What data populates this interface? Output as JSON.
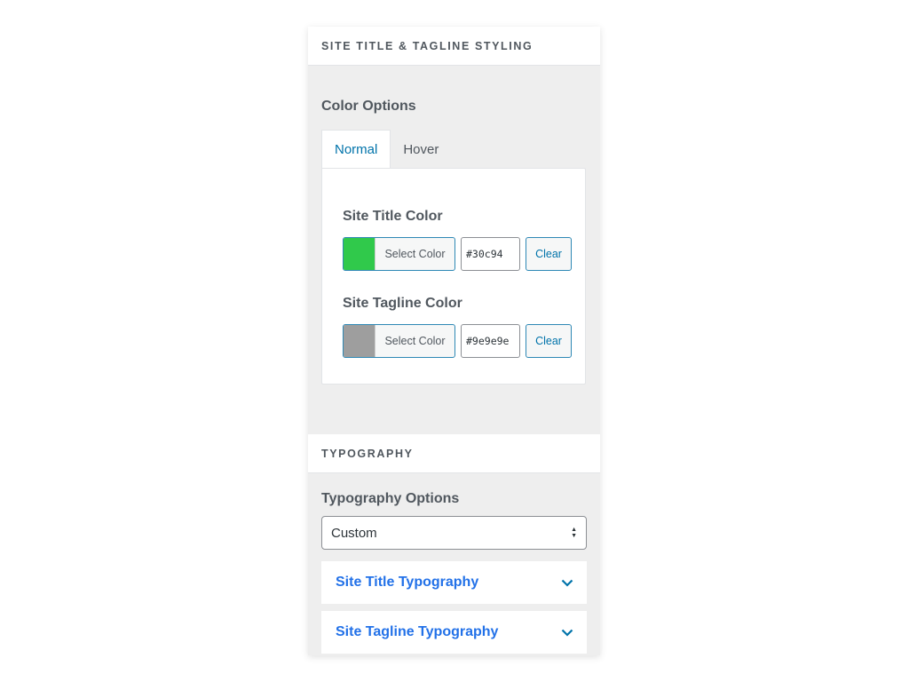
{
  "section_site_title": {
    "heading": "SITE TITLE & TAGLINE STYLING",
    "color_options_title": "Color Options",
    "tabs": [
      {
        "label": "Normal",
        "active": true
      },
      {
        "label": "Hover",
        "active": false
      }
    ],
    "fields": [
      {
        "label": "Site Title Color",
        "swatch_color": "#30c94b",
        "button_label": "Select Color",
        "hex_value": "#30c94",
        "clear_label": "Clear"
      },
      {
        "label": "Site Tagline Color",
        "swatch_color": "#9e9e9e",
        "button_label": "Select Color",
        "hex_value": "#9e9e9e",
        "clear_label": "Clear"
      }
    ]
  },
  "section_typography": {
    "heading": "TYPOGRAPHY",
    "options_title": "Typography Options",
    "select_value": "Custom",
    "accordions": [
      {
        "label": "Site Title Typography",
        "icon": "chevron-down-icon"
      },
      {
        "label": "Site Tagline Typography",
        "icon": "chevron-down-icon"
      }
    ]
  },
  "colors": {
    "accent": "#0073aa",
    "link_blue": "#2271e8",
    "panel_bg": "#eeeeee"
  }
}
